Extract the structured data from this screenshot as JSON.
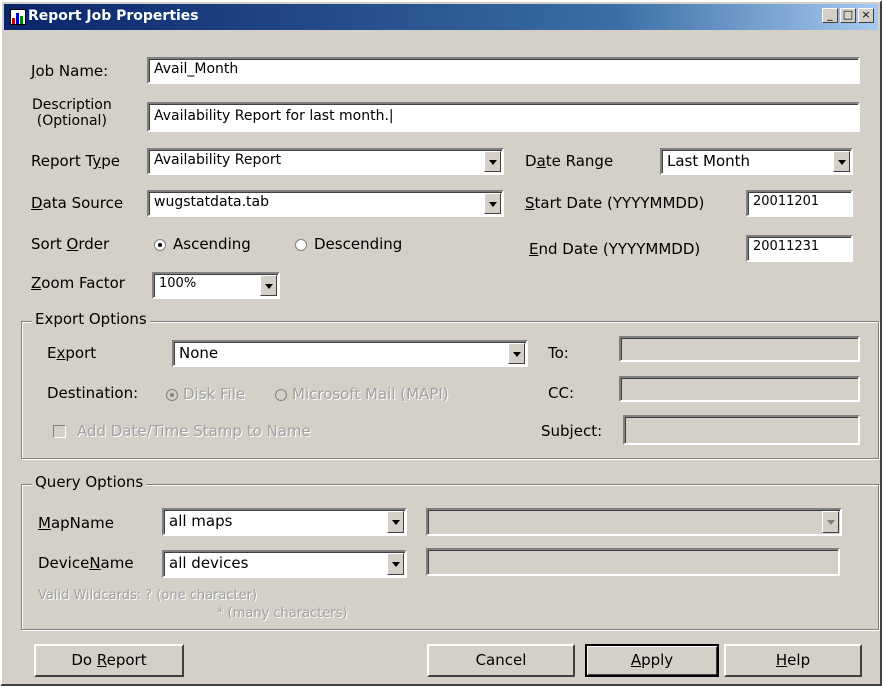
{
  "window": {
    "title": "Report Job Properties",
    "min_glyph": "_",
    "max_glyph": "□",
    "close_glyph": "×"
  },
  "job": {
    "name_label": "Job Name:",
    "name_value": "Avail_Month",
    "desc_label_1": "Description",
    "desc_label_2": "(Optional)",
    "desc_value": "Availability Report for last month.|"
  },
  "report": {
    "type_label": "Report Type",
    "type_value": "Availability Report",
    "source_label": "Data Source",
    "source_value": "wugstatdata.tab",
    "sort_label": "Sort Order",
    "sort_ascending": "Ascending",
    "sort_descending": "Descending",
    "sort_selected": "Ascending",
    "zoom_label": "Zoom Factor",
    "zoom_value": "100%"
  },
  "dates": {
    "range_label": "Date Range",
    "range_value": "Last Month",
    "start_label": "Start Date (YYYYMMDD)",
    "start_value": "20011201",
    "end_label": "End Date (YYYYMMDD)",
    "end_value": "20011231"
  },
  "export": {
    "group_title": "Export Options",
    "export_label": "Export",
    "export_value": "None",
    "destination_label": "Destination:",
    "disk_file": "Disk File",
    "mapi": "Microsoft Mail (MAPI)",
    "stamp_label": "Add Date/Time Stamp to Name",
    "to_label": "To:",
    "to_value": "",
    "cc_label": "CC:",
    "cc_value": "",
    "subject_label": "Subject:",
    "subject_value": ""
  },
  "query": {
    "group_title": "Query Options",
    "mapname_label": "MapName",
    "mapname_value": "all maps",
    "devicename_label": "DeviceName",
    "devicename_value": "all devices",
    "wildcards_line1": "Valid Wildcards: ? (one character)",
    "wildcards_line2": "* (many characters)"
  },
  "buttons": {
    "do_report": "Do Report",
    "cancel": "Cancel",
    "apply": "Apply",
    "help": "Help"
  }
}
